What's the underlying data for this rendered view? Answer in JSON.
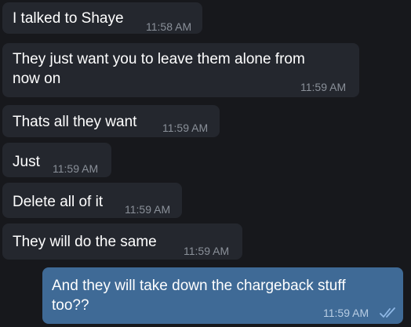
{
  "messages": [
    {
      "text": "I talked to Shaye",
      "time": "11:58 AM",
      "direction": "incoming"
    },
    {
      "text_line1": "They just want you to leave them alone from",
      "text_line2": "now on",
      "time": "11:59 AM",
      "direction": "incoming"
    },
    {
      "text": "Thats all they want",
      "time": "11:59 AM",
      "direction": "incoming"
    },
    {
      "text": "Just",
      "time": "11:59 AM",
      "direction": "incoming"
    },
    {
      "text": "Delete all of it",
      "time": "11:59 AM",
      "direction": "incoming"
    },
    {
      "text": "They will do the same",
      "time": "11:59 AM",
      "direction": "incoming"
    },
    {
      "text_line1": "And they will take down the chargeback stuff",
      "text_line2": "too??",
      "time": "11:59 AM",
      "direction": "outgoing",
      "status_icon": "double-check-icon"
    }
  ],
  "colors": {
    "background": "#17181c",
    "incoming_bubble": "#24272e",
    "outgoing_bubble": "#3f6a96",
    "read_check": "#8fb8e6"
  }
}
